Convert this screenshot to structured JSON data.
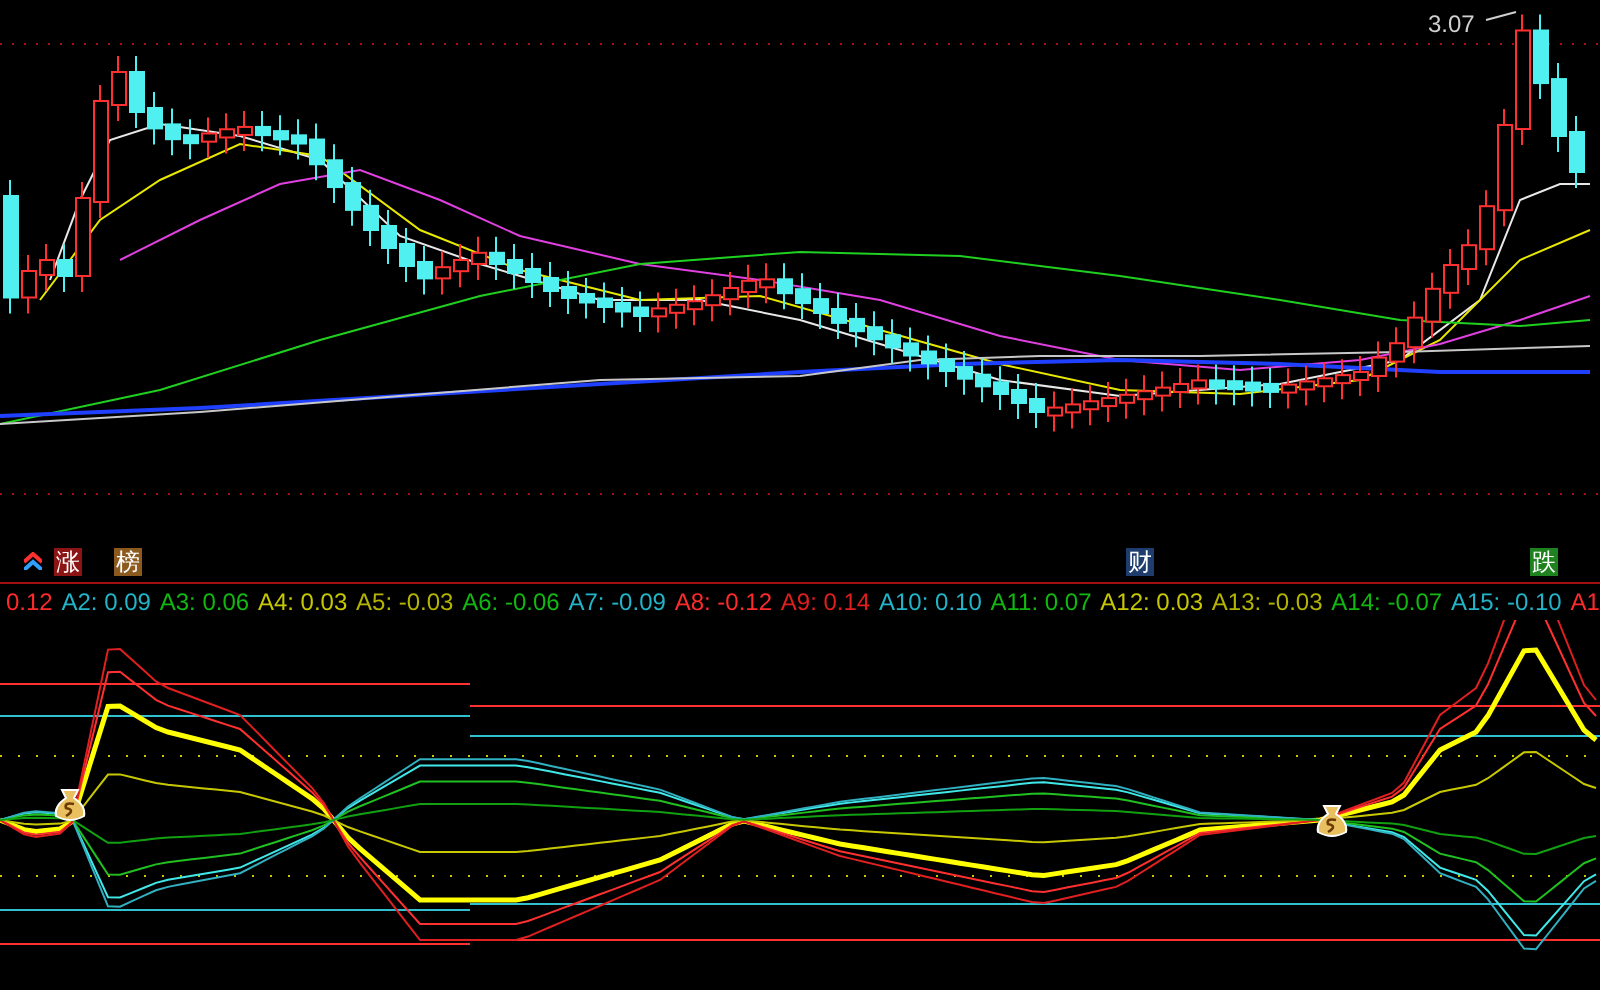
{
  "price_chart": {
    "high_label": "3.07"
  },
  "markers": [
    {
      "text": "涨",
      "color": "#8c1414"
    },
    {
      "text": "榜",
      "color": "#8c5a1e"
    },
    {
      "text": "财",
      "color": "#1e3c6e"
    },
    {
      "text": "跌",
      "color": "#1e821e"
    }
  ],
  "legend": {
    "items": [
      {
        "text": "0.12",
        "color": "#ff2a2a"
      },
      {
        "text": "A2: 0.09",
        "color": "#22b4c8"
      },
      {
        "text": "A3: 0.06",
        "color": "#10b810"
      },
      {
        "text": "A4: 0.03",
        "color": "#c8c800"
      },
      {
        "text": "A5: -0.03",
        "color": "#b4b400"
      },
      {
        "text": "A6: -0.06",
        "color": "#10b810"
      },
      {
        "text": "A7: -0.09",
        "color": "#22b4c8"
      },
      {
        "text": "A8: -0.12",
        "color": "#ff2a2a"
      },
      {
        "text": "A9: 0.14",
        "color": "#e01e1e"
      },
      {
        "text": "A10: 0.10",
        "color": "#22b4c8"
      },
      {
        "text": "A11: 0.07",
        "color": "#10b810"
      },
      {
        "text": "A12: 0.03",
        "color": "#c8c800"
      },
      {
        "text": "A13: -0.03",
        "color": "#b4b400"
      },
      {
        "text": "A14: -0.07",
        "color": "#10b810"
      },
      {
        "text": "A15: -0.10",
        "color": "#22b4c8"
      },
      {
        "text": "A1",
        "color": "#ff2a2a"
      }
    ]
  }
}
